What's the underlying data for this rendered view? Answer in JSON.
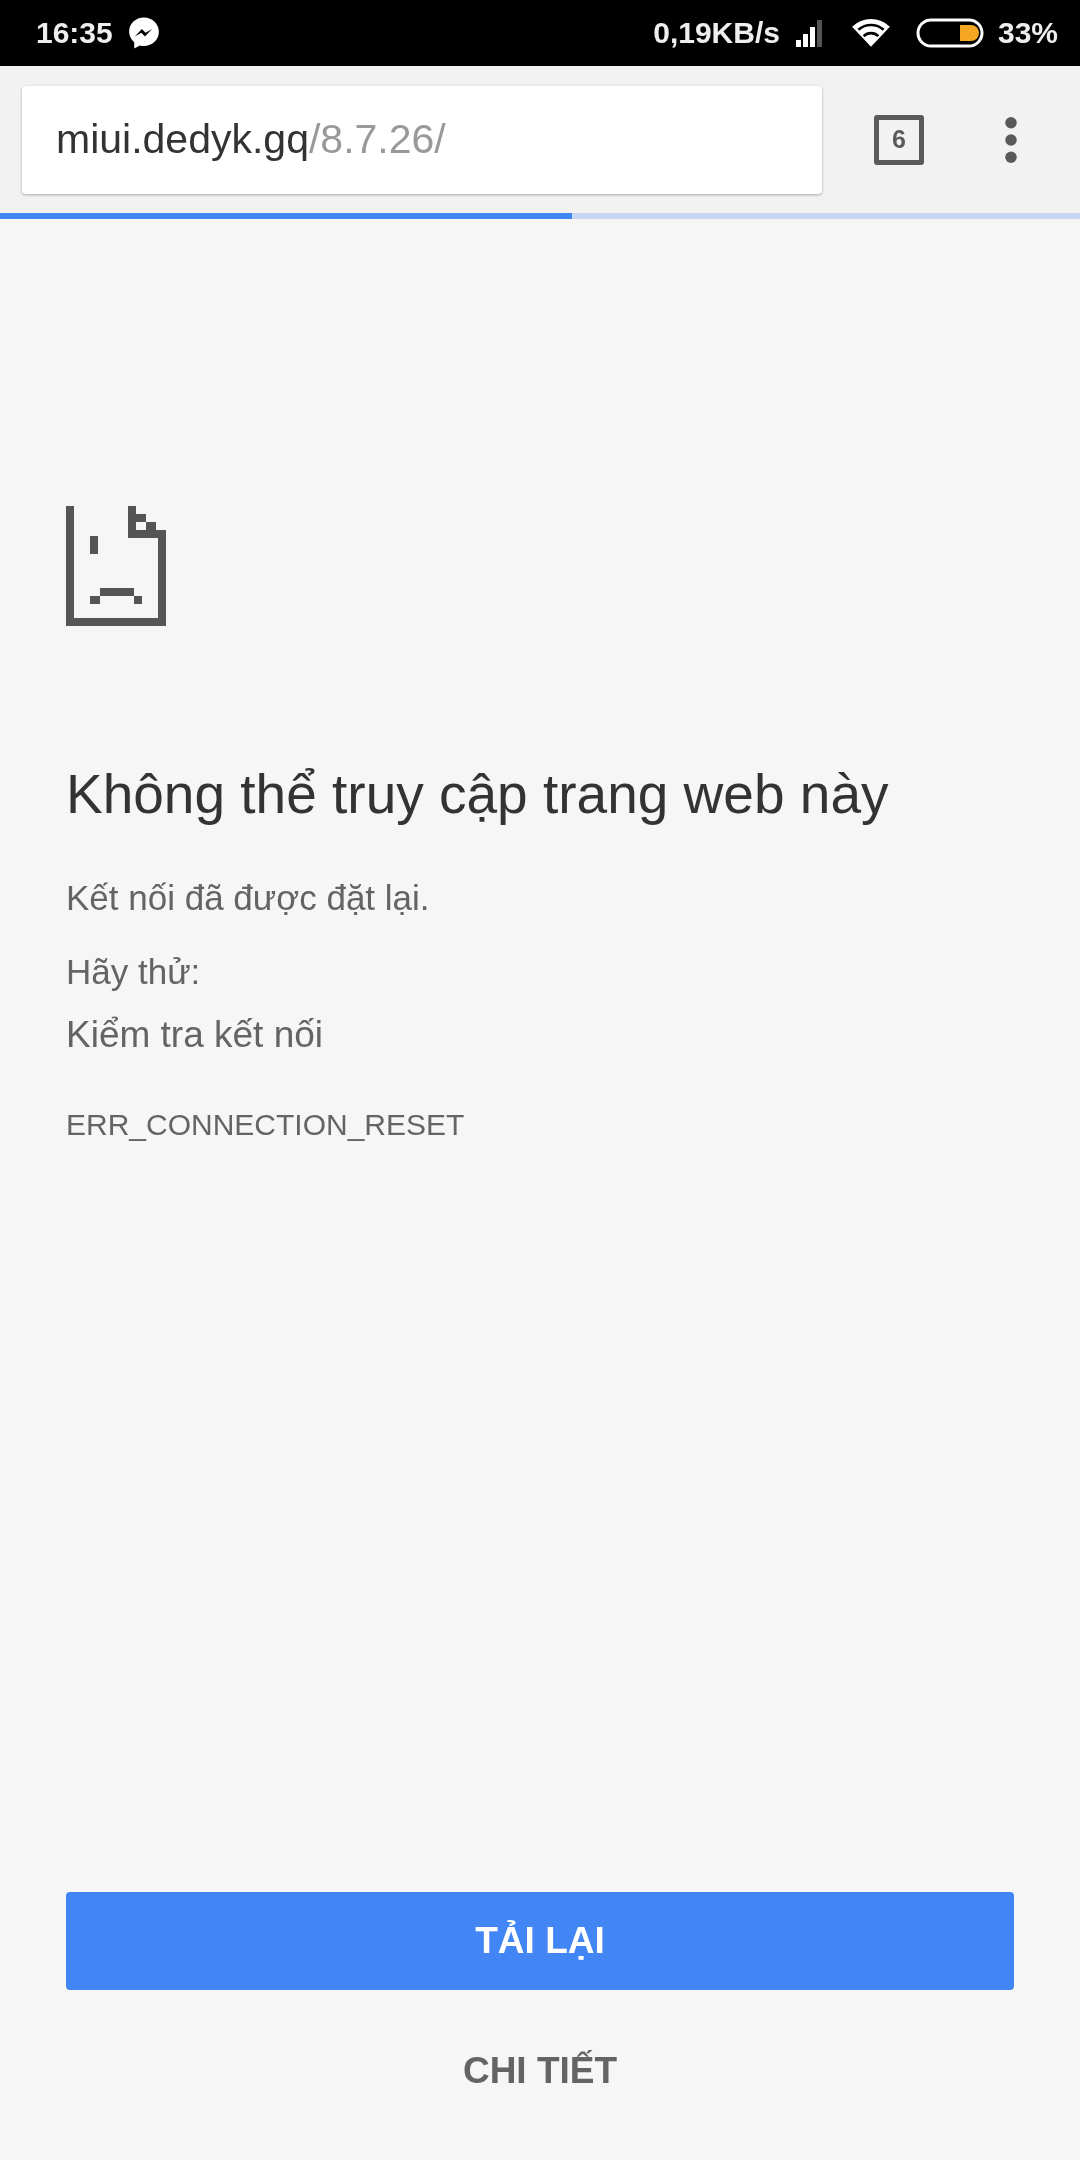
{
  "status_bar": {
    "time": "16:35",
    "speed": "0,19KB/s",
    "battery": "33%"
  },
  "toolbar": {
    "url_host": "miui.dedyk.gq",
    "url_path": "/8.7.26/",
    "tab_count": "6"
  },
  "progress": {
    "level": 0.53
  },
  "error": {
    "title": "Không thể truy cập trang web này",
    "message": "Kết nối đã được đặt lại.",
    "try_label": "Hãy thử:",
    "suggestions": [
      "Kiểm tra kết nối"
    ],
    "code": "ERR_CONNECTION_RESET"
  },
  "buttons": {
    "reload": "TẢI LẠI",
    "details": "CHI TIẾT"
  }
}
